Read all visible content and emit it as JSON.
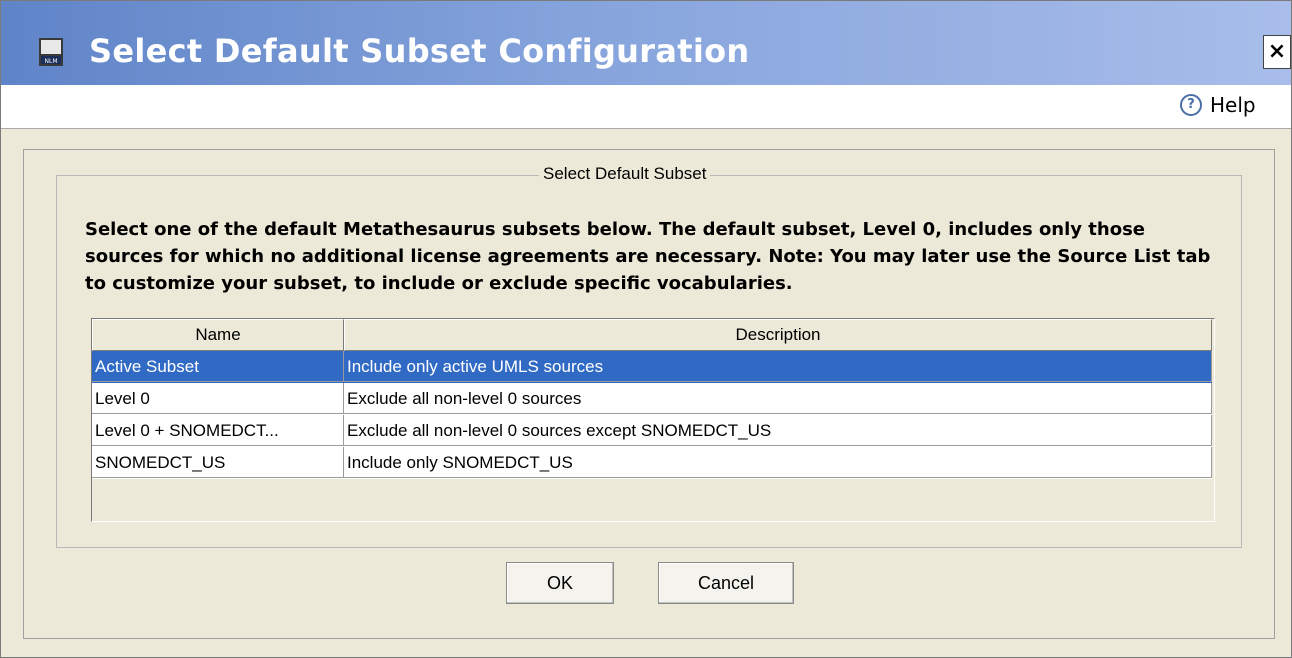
{
  "window": {
    "title": "Select Default Subset Configuration",
    "close_label": "×",
    "app_icon": "nlm-icon"
  },
  "helpbar": {
    "help_label": "Help",
    "help_icon_glyph": "?"
  },
  "panel": {
    "legend": "Select Default Subset",
    "instructions": "Select one of the default Metathesaurus subsets below. The default subset, Level 0, includes only those sources for which no additional license agreements are necessary. Note: You may later use the Source List tab to customize your subset, to include or exclude specific vocabularies."
  },
  "table": {
    "columns": [
      "Name",
      "Description"
    ],
    "rows": [
      {
        "name": "Active Subset",
        "description": "Include only active UMLS sources",
        "selected": true
      },
      {
        "name": "Level 0",
        "description": "Exclude all non-level 0 sources",
        "selected": false
      },
      {
        "name": "Level 0 + SNOMEDCT...",
        "description": "Exclude all non-level 0 sources except SNOMEDCT_US",
        "selected": false
      },
      {
        "name": "SNOMEDCT_US",
        "description": "Include only SNOMEDCT_US",
        "selected": false
      }
    ]
  },
  "buttons": {
    "ok_label": "OK",
    "cancel_label": "Cancel"
  },
  "colors": {
    "selection": "#316ac5",
    "titlebar_start": "#5f84c8",
    "titlebar_end": "#a8bdea"
  }
}
